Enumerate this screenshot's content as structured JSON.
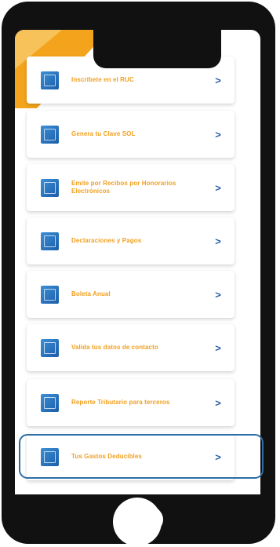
{
  "menu": {
    "items": [
      {
        "label": "Inscríbete en el RUC",
        "icon": "id-card-icon"
      },
      {
        "label": "Genera tu Clave SOL",
        "icon": "key-icon"
      },
      {
        "label": "Emite por Recibos por Honorarios Electrónicos",
        "icon": "receipt-icon"
      },
      {
        "label": "Declaraciones y Pagos",
        "icon": "document-icon"
      },
      {
        "label": "Boleta Anual",
        "icon": "card-icon"
      },
      {
        "label": "Valida tus datos de contacto",
        "icon": "contact-icon"
      },
      {
        "label": "Reporte Tributario para terceros",
        "icon": "report-icon"
      },
      {
        "label": "Tus Gastos Deducibles",
        "icon": "expenses-icon"
      }
    ],
    "chevron": ">"
  },
  "colors": {
    "accent": "#f0a020",
    "brand_blue": "#1b5ea8",
    "highlight_border": "#2e6da4"
  }
}
